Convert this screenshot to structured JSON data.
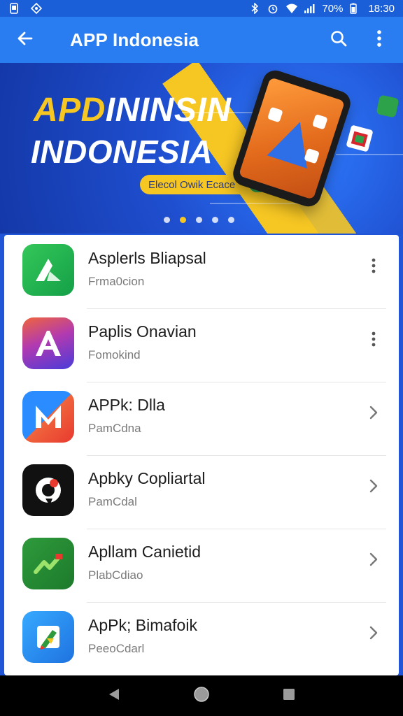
{
  "status_bar": {
    "battery_text": "70%",
    "time": "18:30"
  },
  "app_bar": {
    "title": "APP Indonesia",
    "back_icon": "arrow-left-icon",
    "search_icon": "search-icon",
    "more_icon": "more-vertical-icon"
  },
  "banner": {
    "headline_line1_yellow": "APD",
    "headline_line1_white": "ININSIN",
    "headline_line2": "INDONESIA",
    "pill_text": "Elecol Owik Ecace",
    "pager_dots": 5,
    "active_dot": 1
  },
  "apps": [
    {
      "name": "Asplerls Bliapsal",
      "subtitle": "Frma0cion",
      "trailing": "more-vertical-icon"
    },
    {
      "name": "Paplis Onavian",
      "subtitle": "Fomokind",
      "trailing": "more-vertical-icon"
    },
    {
      "name": "APPk: Dlla",
      "subtitle": "PamCdna",
      "trailing": "chevron-right-icon"
    },
    {
      "name": "Apbky Copliartal",
      "subtitle": "PamCdal",
      "trailing": "chevron-right-icon"
    },
    {
      "name": "Apllam Canietid",
      "subtitle": "PlabCdiao",
      "trailing": "chevron-right-icon"
    },
    {
      "name": "ApPk; Bimafoik",
      "subtitle": "PeeoCdarl",
      "trailing": "chevron-right-icon"
    }
  ],
  "nav_bar": {
    "back_icon": "nav-back-icon",
    "home_icon": "nav-home-icon",
    "recents_icon": "nav-recents-icon"
  },
  "colors": {
    "app_bar": "#2a7df0",
    "banner_blue": "#1f4fd0",
    "accent_yellow": "#f6c623"
  }
}
